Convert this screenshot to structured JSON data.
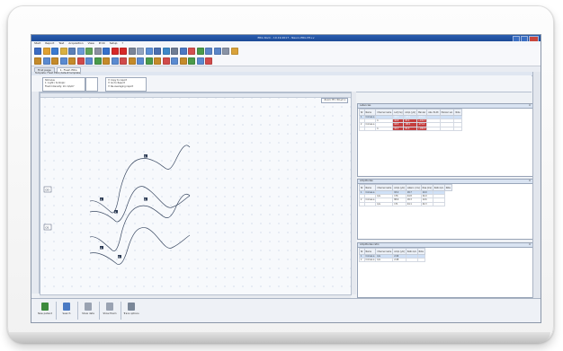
{
  "window": {
    "title": "ERG Rock - 10.19.2017 - Neuro-ERG P3+v"
  },
  "menu": [
    "Start",
    "Report",
    "Test",
    "Acquisition",
    "View",
    "Print",
    "Setup",
    "?"
  ],
  "toolbar_row1_icons": [
    {
      "name": "open-icon",
      "color": "#3b6cc4"
    },
    {
      "name": "patient-icon",
      "color": "#e0a030"
    },
    {
      "name": "save-icon",
      "color": "#3a7ad0"
    },
    {
      "name": "folder-icon",
      "color": "#d9b040"
    },
    {
      "name": "print-icon",
      "color": "#5a7fb8"
    },
    {
      "name": "chart-icon",
      "color": "#6b9ad8"
    },
    {
      "name": "report-icon",
      "color": "#5fa45a"
    },
    {
      "name": "camera-icon",
      "color": "#8a8fa0"
    },
    {
      "name": "play-icon",
      "color": "#3570cc"
    },
    {
      "name": "record-icon",
      "color": "#d62828"
    },
    {
      "name": "stop-icon",
      "color": "#d62828"
    },
    {
      "name": "pause-icon",
      "color": "#7a8598"
    },
    {
      "name": "grid-icon",
      "color": "#93a4c0"
    },
    {
      "name": "layout-icon",
      "color": "#5b8fd6"
    },
    {
      "name": "cursor-icon",
      "color": "#4a6fb0"
    },
    {
      "name": "marker-icon",
      "color": "#3d88c9"
    },
    {
      "name": "baseline-icon",
      "color": "#6f7d94"
    },
    {
      "name": "wave-icon",
      "color": "#4c78c2"
    },
    {
      "name": "filter-icon",
      "color": "#d24f4f"
    },
    {
      "name": "average-icon",
      "color": "#4a9a4a"
    },
    {
      "name": "zoom-in-icon",
      "color": "#5a85c8"
    },
    {
      "name": "zoom-out-icon",
      "color": "#5a85c8"
    },
    {
      "name": "settings-icon",
      "color": "#8993a6"
    },
    {
      "name": "users-icon",
      "color": "#d9a23a"
    }
  ],
  "toolbar_row2_icons": [
    {
      "name": "trace-1-icon",
      "color": "#c48a2a"
    },
    {
      "name": "trace-2-icon",
      "color": "#5a8ad0"
    },
    {
      "name": "trace-3-icon",
      "color": "#c48a2a"
    },
    {
      "name": "trace-4-icon",
      "color": "#5a8ad0"
    },
    {
      "name": "trace-5-icon",
      "color": "#c48a2a"
    },
    {
      "name": "trace-6-icon",
      "color": "#d04a4a"
    },
    {
      "name": "trace-7-icon",
      "color": "#5a8ad0"
    },
    {
      "name": "trace-8-icon",
      "color": "#4a9a4a"
    },
    {
      "name": "trace-9-icon",
      "color": "#c48a2a"
    },
    {
      "name": "trace-10-icon",
      "color": "#5a8ad0"
    },
    {
      "name": "trace-11-icon",
      "color": "#d04a4a"
    },
    {
      "name": "trace-12-icon",
      "color": "#c48a2a"
    },
    {
      "name": "trace-13-icon",
      "color": "#5a8ad0"
    },
    {
      "name": "trace-14-icon",
      "color": "#4a9a4a"
    },
    {
      "name": "trace-15-icon",
      "color": "#c48a2a"
    },
    {
      "name": "trace-16-icon",
      "color": "#d04a4a"
    },
    {
      "name": "trace-17-icon",
      "color": "#5a8ad0"
    },
    {
      "name": "trace-18-icon",
      "color": "#c48a2a"
    },
    {
      "name": "trace-19-icon",
      "color": "#4a9a4a"
    },
    {
      "name": "trace-20-icon",
      "color": "#5a8ad0"
    },
    {
      "name": "trace-21-icon",
      "color": "#d04a4a"
    }
  ],
  "tabs": [
    {
      "label": "First page"
    },
    {
      "label": "1. Flash ERG"
    }
  ],
  "template_bar": "Template: Flash ERG (default template)",
  "options": {
    "stimulus": [
      "Stimulus",
      "1: Light / Scotopic",
      "Flash Intensity: 10 cd/s/m²"
    ],
    "report": [
      "Copy to report",
      "Go to Report",
      "Re-averaging report"
    ]
  },
  "graph": {
    "zoom_label": "Zoom: Fit / 50 µV ▾",
    "row_labels": [
      "OD",
      "OS"
    ],
    "markers": [
      "a",
      "b",
      "a",
      "b",
      "a",
      "b"
    ]
  },
  "panes": {
    "top": {
      "title": "Latencies",
      "headers": [
        "Nr",
        "Name",
        "Channel name",
        "Lat [ms]",
        "Ampl. [µV]",
        "Mar-ker",
        "Abs. Pk-Pk",
        "Mar-ker val.",
        "Note"
      ],
      "rows": [
        [
          "1",
          "Cornea a",
          "",
          "18.7",
          "-93.2",
          "-176.1",
          "",
          "",
          ""
        ],
        [
          "",
          "",
          "b",
          "44.8",
          "83.4",
          "+192.7",
          "",
          "",
          ""
        ],
        [
          "2",
          "Cornea a",
          "",
          "18.3",
          "-88.6",
          "-171.4",
          "",
          "",
          ""
        ],
        [
          "",
          "",
          "b",
          "44.1",
          "82.0",
          "+186.5",
          "",
          "",
          ""
        ]
      ]
    },
    "middle": {
      "title": "Amplitudes",
      "headers": [
        "Nr",
        "Name",
        "Channel name",
        "Ampl. [µV]",
        "Latenc. [ms]",
        "Rise [ms]",
        "Ratio b/a",
        "Note"
      ],
      "rows": [
        [
          "1",
          "Cornea a",
          "",
          "93.2",
          "18.7",
          "10.9",
          ""
        ],
        [
          "",
          "",
          "b/a",
          "176",
          "44.8",
          "24.9",
          ""
        ],
        [
          "2",
          "Cornea a",
          "",
          "88.6",
          "18.3",
          "10.6",
          ""
        ],
        [
          "",
          "",
          "b/a",
          "171",
          "44.1",
          "24.3",
          ""
        ]
      ]
    },
    "bottom": {
      "title": "Amplitudes ratio",
      "headers": [
        "Nr",
        "Name",
        "Channel name",
        "Ampl. [µV]",
        "Ratio b/a",
        "Note"
      ],
      "rows": [
        [
          "1",
          "Cornea a",
          "b/a",
          "2.06",
          "",
          ""
        ],
        [
          "2",
          "Cornea a",
          "b/a",
          "2.08",
          "",
          ""
        ]
      ]
    }
  },
  "bottom_buttons": [
    {
      "label": "New patient",
      "icon": "new-patient-icon",
      "color": "#3c8a3c"
    },
    {
      "label": "Search",
      "icon": "search-patient-icon",
      "color": "#4a7ac4"
    },
    {
      "label": "Show data",
      "icon": "show-data-icon",
      "color": "#9aa3b2"
    },
    {
      "label": "Show Exam",
      "icon": "show-exam-icon",
      "color": "#9aa3b2"
    },
    {
      "label": "Trace options",
      "icon": "trace-options-icon",
      "color": "#7a8798"
    }
  ]
}
